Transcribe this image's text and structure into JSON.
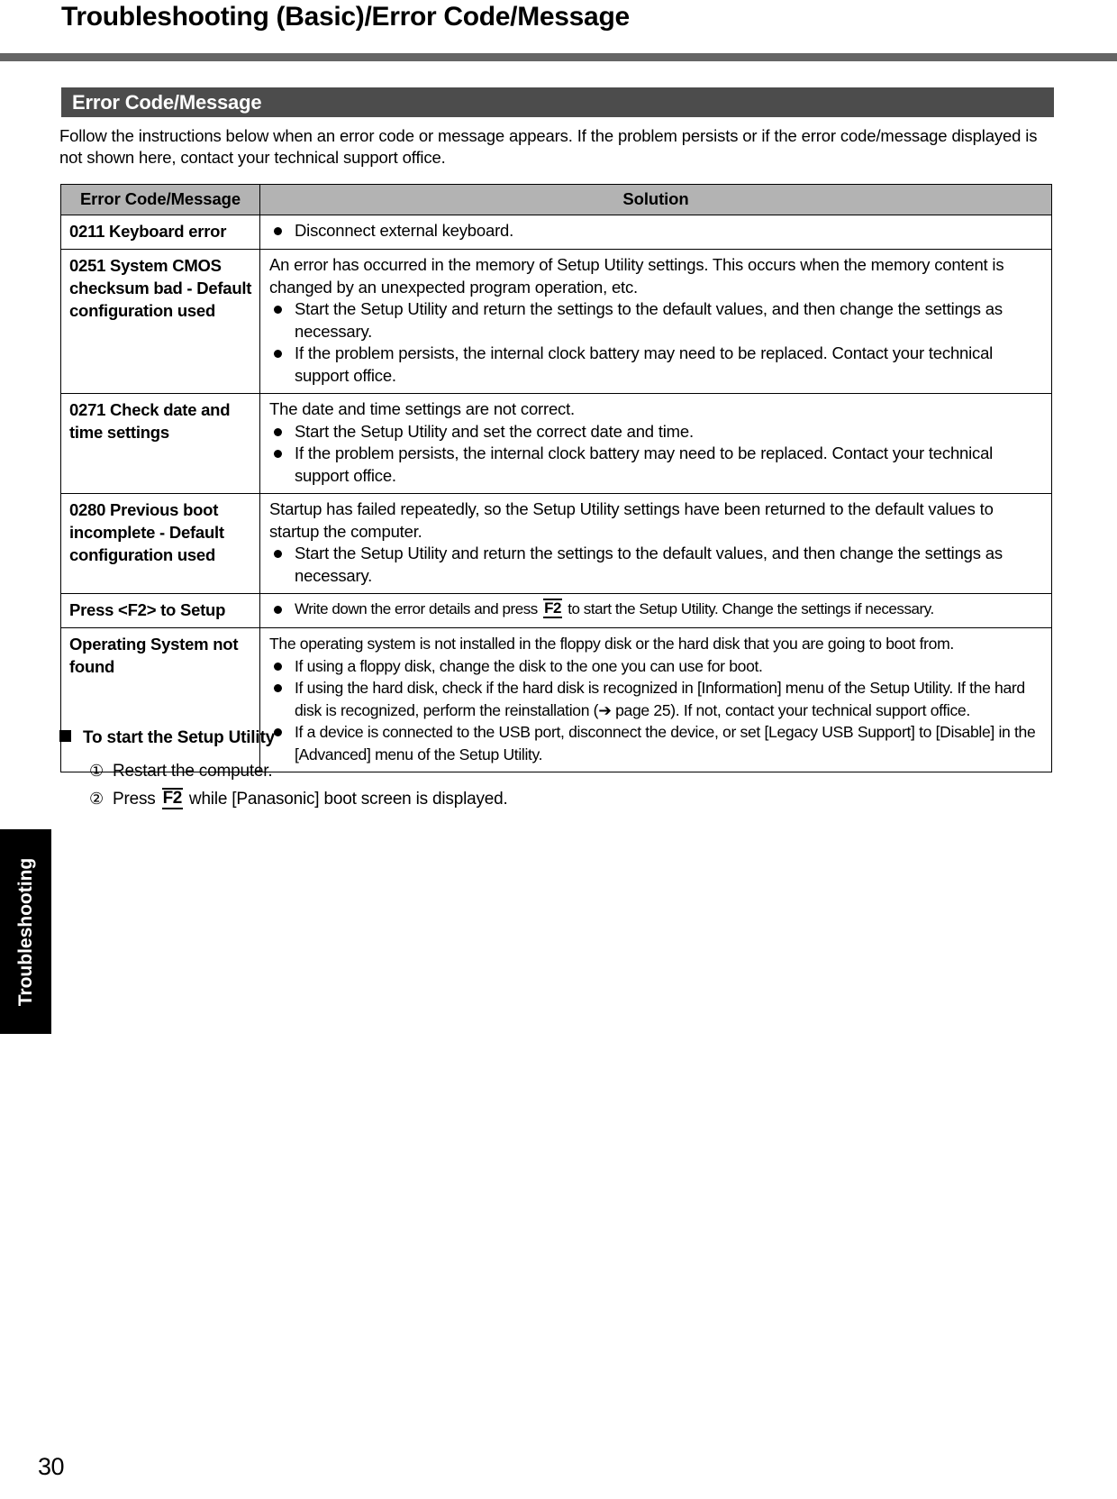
{
  "header": {
    "title": "Troubleshooting (Basic)/Error Code/Message"
  },
  "section": {
    "band_label": "Error Code/Message",
    "intro": "Follow the instructions below when an error code or message appears. If the problem persists or if the error code/message displayed is not shown here, contact your technical support office."
  },
  "table": {
    "columns": [
      "Error Code/Message",
      "Solution"
    ],
    "rows": [
      {
        "code": "0211 Keyboard error",
        "intro": "",
        "bullets": [
          "Disconnect external keyboard."
        ]
      },
      {
        "code": "0251 System CMOS checksum bad - Default configuration used",
        "intro": "An error has occurred in the memory of Setup Utility settings. This occurs when the memory content is changed by an unexpected program operation, etc.",
        "bullets": [
          "Start the Setup Utility and return the settings to the default values, and then change the settings as necessary.",
          "If the problem persists, the internal clock battery may need to be replaced. Contact your technical support office."
        ]
      },
      {
        "code": "0271 Check date and time settings",
        "intro": "The date and time settings are not correct.",
        "bullets": [
          "Start the Setup Utility and set the correct date and time.",
          "If the problem persists, the internal clock battery may need to be replaced. Contact your technical support office."
        ]
      },
      {
        "code": "0280 Previous boot incomplete - Default configuration used",
        "intro": "Startup has failed repeatedly, so the Setup Utility settings have been returned to the default values to startup the computer.",
        "bullets": [
          "Start the Setup Utility and return the settings to the default values, and then change the settings as necessary."
        ]
      },
      {
        "code": "Press <F2> to Setup",
        "intro": "",
        "bullets_rich": [
          {
            "pre": "Write down the error details and press ",
            "key": "F2",
            "post": " to start the Setup Utility. Change the settings if necessary."
          }
        ]
      },
      {
        "code": "Operating System not found",
        "intro": "The operating system is not installed in the floppy disk or the hard disk that you are going to boot from.",
        "bullets": [
          "If using a floppy disk, change the disk to the one you can use for boot.",
          "If using the hard disk, check if the hard disk is recognized in [Information] menu of the Setup Utility. If the hard disk is recognized, perform the reinstallation (➔ page 25). If not, contact your technical support office.",
          "If a device is connected to the USB port, disconnect the device, or set [Legacy USB Support] to [Disable] in the [Advanced] menu of the Setup Utility."
        ]
      }
    ]
  },
  "subsection": {
    "heading": "To start the Setup Utility",
    "steps": [
      {
        "num": "①",
        "pre": "Restart the computer.",
        "key": "",
        "post": ""
      },
      {
        "num": "②",
        "pre": "Press ",
        "key": "F2",
        "post": " while [Panasonic] boot screen is displayed."
      }
    ]
  },
  "side_tab": {
    "label": "Troubleshooting"
  },
  "footer": {
    "page_number": "30"
  },
  "colors": {
    "header_rule": "#656565",
    "section_band": "#4c4c4c",
    "table_header": "#b3b3b3",
    "side_tab": "#000000"
  }
}
